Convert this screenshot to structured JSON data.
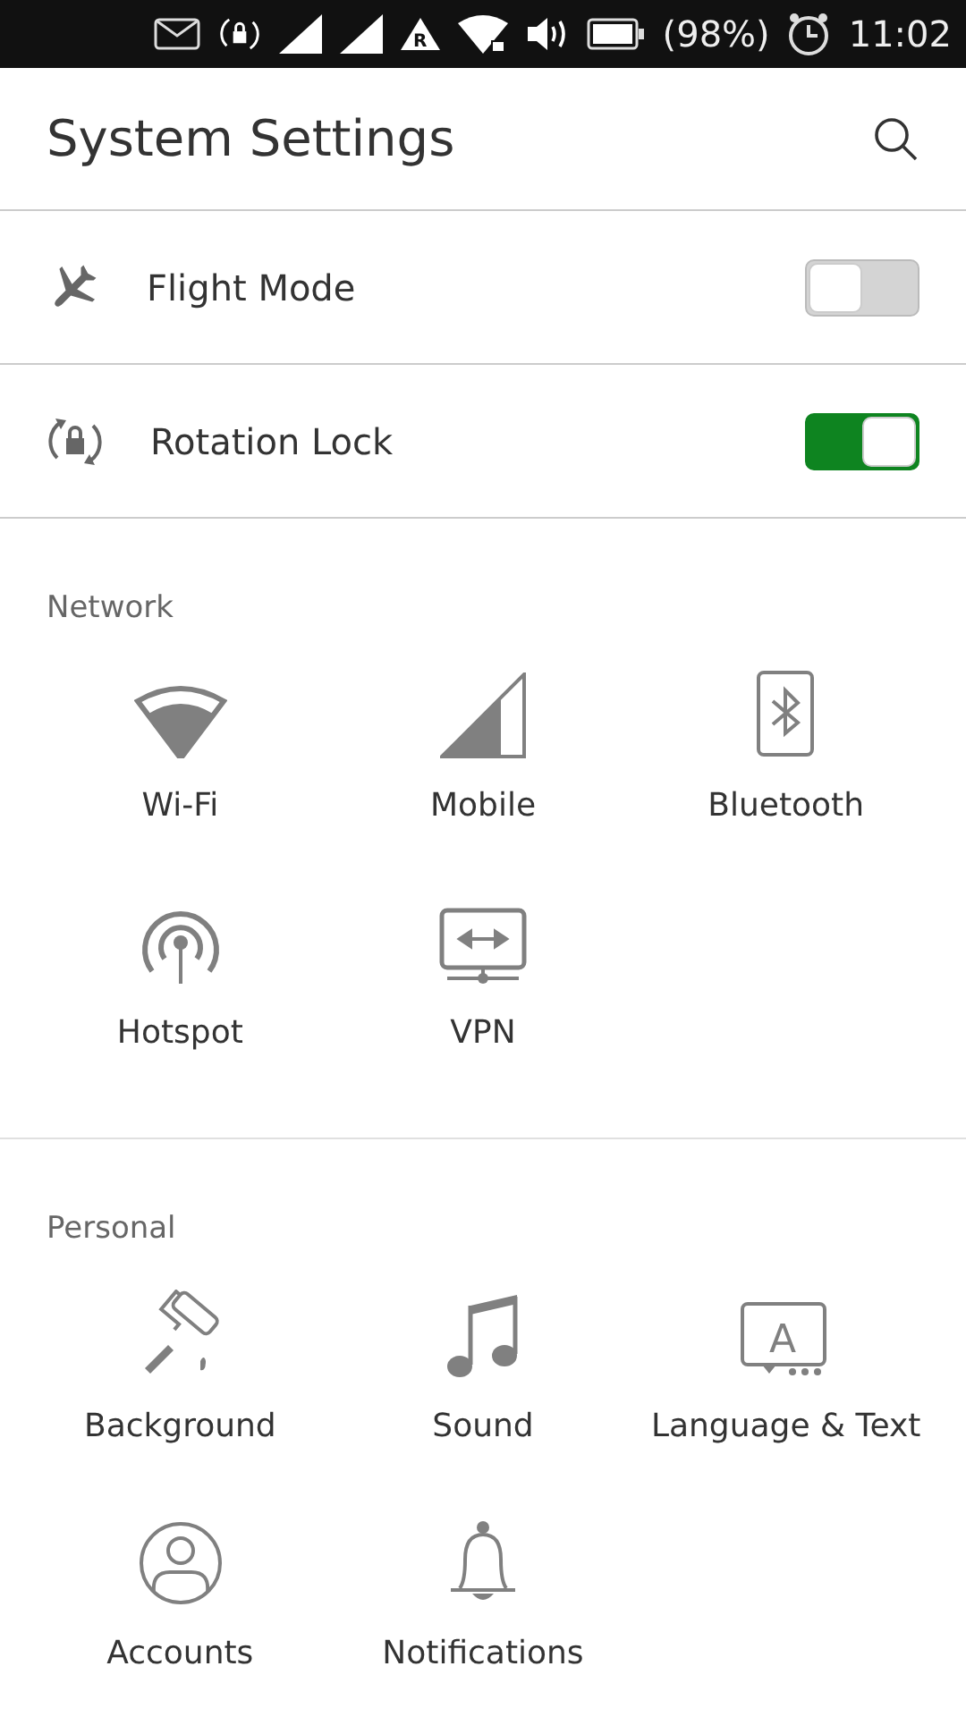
{
  "status_bar": {
    "roaming_glyph": "R",
    "battery_text": "(98%)",
    "time": "11:02"
  },
  "header": {
    "title": "System Settings"
  },
  "toggles": [
    {
      "kind": "plane",
      "label": "Flight Mode",
      "on": false
    },
    {
      "kind": "rotation",
      "label": "Rotation Lock",
      "on": true
    }
  ],
  "sections": [
    {
      "title": "Network",
      "items": [
        {
          "kind": "wifi",
          "label": "Wi-Fi"
        },
        {
          "kind": "mobile",
          "label": "Mobile"
        },
        {
          "kind": "bluetooth",
          "label": "Bluetooth"
        },
        {
          "kind": "hotspot",
          "label": "Hotspot"
        },
        {
          "kind": "vpn",
          "label": "VPN"
        }
      ]
    },
    {
      "title": "Personal",
      "items": [
        {
          "kind": "roller",
          "label": "Background"
        },
        {
          "kind": "music",
          "label": "Sound"
        },
        {
          "kind": "language",
          "label": "Language & Text",
          "glyph": "A"
        },
        {
          "kind": "person",
          "label": "Accounts"
        },
        {
          "kind": "bell",
          "label": "Notifications"
        }
      ]
    }
  ]
}
